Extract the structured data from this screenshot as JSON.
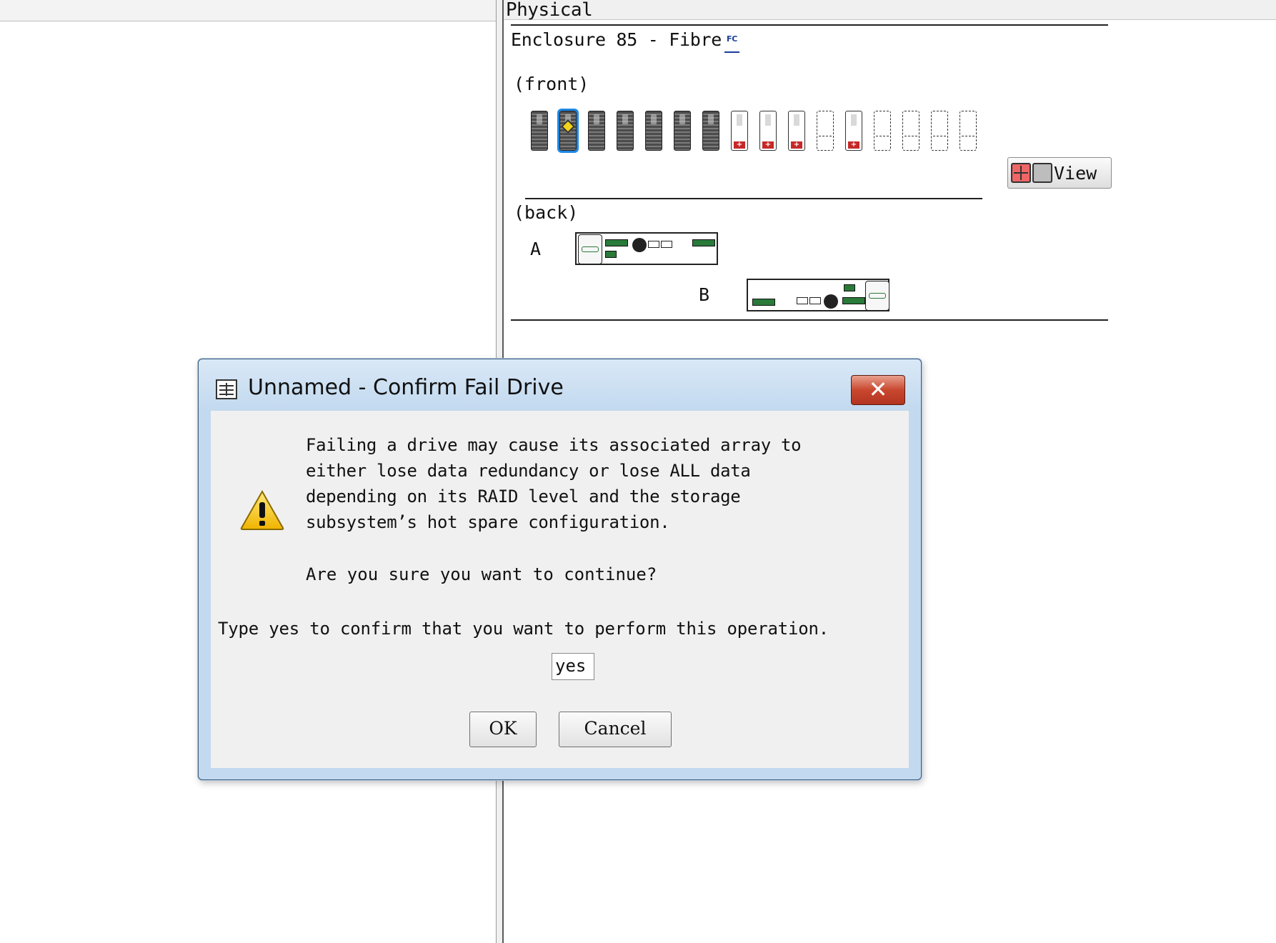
{
  "tab": {
    "label": "Physical"
  },
  "enclosure": {
    "title": "Enclosure 85 - Fibre",
    "badge": "FC",
    "front_label": "(front)",
    "back_label": "(back)",
    "controller_a_label": "A",
    "controller_b_label": "B",
    "drives": [
      "dark",
      "selected",
      "dark",
      "dark",
      "dark",
      "dark",
      "dark",
      "failed",
      "failed",
      "failed",
      "empty",
      "failed",
      "empty",
      "empty",
      "empty",
      "empty"
    ],
    "view_button_label": "View"
  },
  "dialog": {
    "title": "Unnamed - Confirm Fail Drive",
    "close_symbol": "✕",
    "message": "Failing a drive may cause its associated array to\neither lose data redundancy or lose ALL data\ndepending on its RAID level and the storage\nsubsystem’s hot spare configuration.",
    "question": "Are you sure you want to continue?",
    "instruction": "Type yes to confirm that you want to perform this operation.",
    "input_value": "yes",
    "ok_label": "OK",
    "cancel_label": "Cancel",
    "icon": "warning-icon"
  }
}
